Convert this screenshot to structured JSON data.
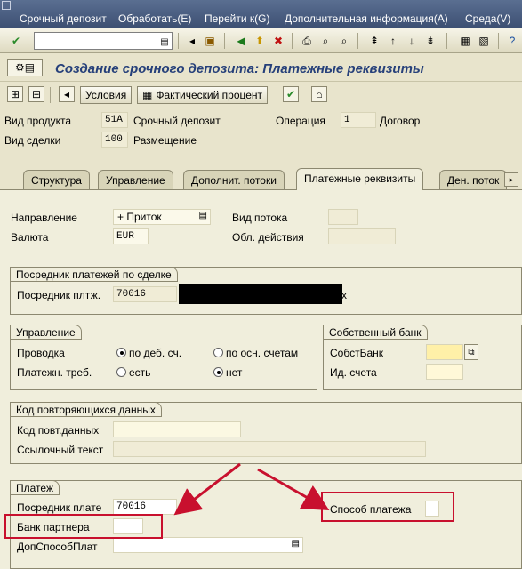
{
  "menu": {
    "items": [
      "Срочный депозит",
      "Обработать(E)",
      "Перейти к(G)",
      "Дополнительная информация(A)",
      "Среда(V)"
    ]
  },
  "title": "Создание срочного депозита: Платежные реквизиты",
  "toolbar2": {
    "conditions": "Условия",
    "actual_rate": "Фактический процент"
  },
  "header": {
    "product_type_label": "Вид продукта",
    "product_type_code": "51A",
    "product_type_text": "Срочный депозит",
    "operation_label": "Операция",
    "operation_value": "1",
    "operation_text": "Договор",
    "deal_type_label": "Вид сделки",
    "deal_type_code": "100",
    "deal_type_text": "Размещение"
  },
  "tabs": [
    "Структура",
    "Управление",
    "Дополнит. потоки",
    "Платежные реквизиты",
    "Ден. поток"
  ],
  "flow": {
    "direction_label": "Направление",
    "direction_value": "+ Приток",
    "currency_label": "Валюта",
    "currency_value": "EUR",
    "flow_type_label": "Вид потока",
    "scope_label": "Обл. действия"
  },
  "intermediary": {
    "title": "Посредник платежей по сделке",
    "label": "Посредник плтж.",
    "value": "70016",
    "trailing": "x"
  },
  "control": {
    "title": "Управление",
    "posting_label": "Проводка",
    "opt_debit": "по деб. сч.",
    "opt_main": "по осн. счетам",
    "payreq_label": "Платежн. треб.",
    "opt_yes": "есть",
    "opt_no": "нет"
  },
  "own_bank": {
    "title": "Собственный банк",
    "bank_label": "СобстБанк",
    "account_label": "Ид. счета"
  },
  "repeat": {
    "title": "Код повторяющихся данных",
    "code_label": "Код повт.данных",
    "ref_label": "Ссылочный текст"
  },
  "payment": {
    "title": "Платеж",
    "intermediary_label": "Посредник плате",
    "intermediary_value": "70016",
    "partner_bank_label": "Банк партнера",
    "extra_method_label": "ДопСпособПлат",
    "method_label": "Способ платежа"
  },
  "colors": {
    "title": "#26407a",
    "annotation": "#c8102e",
    "panel": "#f0eedc"
  }
}
